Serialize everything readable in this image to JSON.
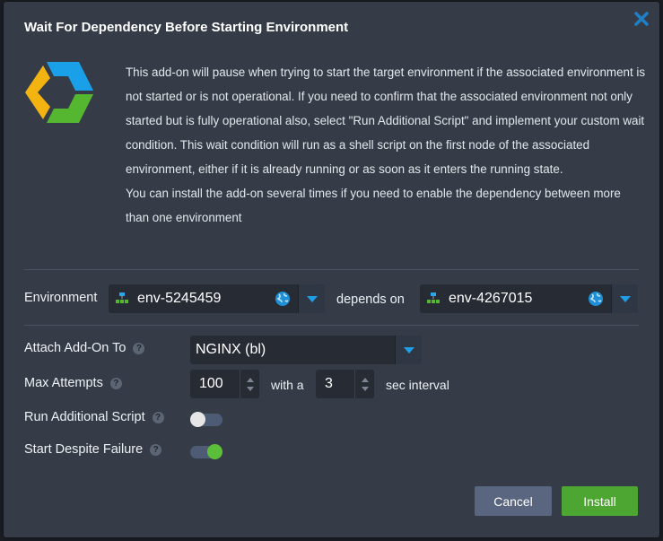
{
  "dialog": {
    "title": "Wait For Dependency Before Starting Environment",
    "description": [
      "This add-on will pause when trying to start the target environment if the associated environment is not started or is not operational. If you need to confirm that the associated environment not only started but is fully operational also, select \"Run Additional Script\" and implement your custom wait condition. This wait condition will run as a shell script on the first node of the associated environment, either if it is already running or as soon as it enters the running state.",
      "You can install the add-on several times if you need to enable the dependency between more than one environment"
    ]
  },
  "environment": {
    "label": "Environment",
    "source_env": "env-5245459",
    "depends_label": "depends on",
    "target_env": "env-4267015"
  },
  "attach": {
    "label": "Attach Add-On To",
    "value": "NGINX (bl)"
  },
  "attempts": {
    "label": "Max Attempts",
    "value": "100",
    "with_label": "with a",
    "interval": "3",
    "interval_label": "sec interval"
  },
  "script": {
    "label": "Run Additional Script",
    "enabled": false
  },
  "failure": {
    "label": "Start Despite Failure",
    "enabled": true
  },
  "buttons": {
    "cancel": "Cancel",
    "install": "Install"
  },
  "colors": {
    "accent": "#1f9ee6",
    "install": "#4ea632",
    "cancel": "#5a6680",
    "toggle_on_knob": "#5cbf3a",
    "toggle_off_knob": "#e6e6e6"
  }
}
